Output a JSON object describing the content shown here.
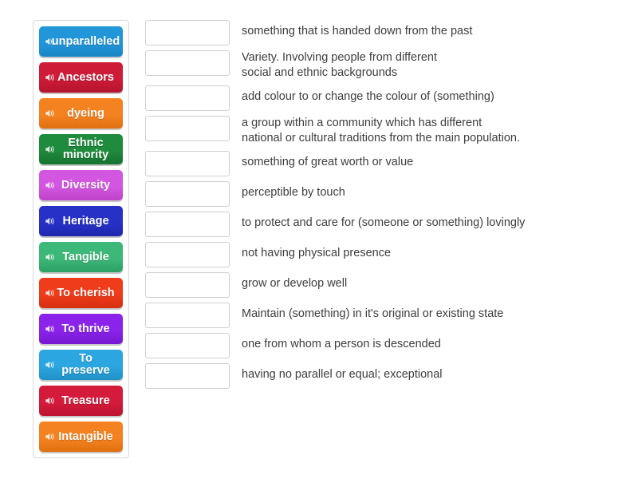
{
  "tiles": {
    "panel_name": "word-tiles",
    "items": [
      {
        "label": "unparalleled",
        "color": "#2196d9",
        "color_dark": "#1b86c4",
        "icon": "speaker-icon"
      },
      {
        "label": "Ancestors",
        "color": "#ce1b37",
        "color_dark": "#b5142e",
        "icon": "speaker-icon"
      },
      {
        "label": "dyeing",
        "color": "#f58220",
        "color_dark": "#e0700f",
        "icon": "speaker-icon"
      },
      {
        "label": "Ethnic\nminority",
        "color": "#1f8b3d",
        "color_dark": "#177331",
        "icon": "speaker-icon"
      },
      {
        "label": "Diversity",
        "color": "#d356e0",
        "color_dark": "#bd42c9",
        "icon": "speaker-icon"
      },
      {
        "label": "Heritage",
        "color": "#2731c7",
        "color_dark": "#1f27ad",
        "icon": "speaker-icon"
      },
      {
        "label": "Tangible",
        "color": "#3cb878",
        "color_dark": "#2ea165",
        "icon": "speaker-icon"
      },
      {
        "label": "To cherish",
        "color": "#ef3c1a",
        "color_dark": "#d52f10",
        "icon": "speaker-icon"
      },
      {
        "label": "To thrive",
        "color": "#8b23ea",
        "color_dark": "#7718d0",
        "icon": "speaker-icon"
      },
      {
        "label": "To\npreserve",
        "color": "#2ba6e0",
        "color_dark": "#2091c7",
        "icon": "speaker-icon"
      },
      {
        "label": "Treasure",
        "color": "#d51b3b",
        "color_dark": "#bb1431",
        "icon": "speaker-icon"
      },
      {
        "label": "Intangible",
        "color": "#f58220",
        "color_dark": "#e0700f",
        "icon": "speaker-icon"
      }
    ]
  },
  "answers": {
    "panel_name": "definition-answers",
    "drop_box_value": "",
    "rows": [
      {
        "definition": "something that is handed down from the past",
        "lines": 1
      },
      {
        "definition": "Variety. Involving people from different\nsocial and ethnic backgrounds",
        "lines": 2
      },
      {
        "definition": "add colour to or change the colour of (something)",
        "lines": 1
      },
      {
        "definition": "a group within a community which has different\nnational or cultural traditions from the main population.",
        "lines": 2
      },
      {
        "definition": "something of great worth or value",
        "lines": 1
      },
      {
        "definition": "perceptible by touch",
        "lines": 1
      },
      {
        "definition": "to protect and care for (someone or something) lovingly",
        "lines": 1
      },
      {
        "definition": "not having physical presence",
        "lines": 1
      },
      {
        "definition": "grow or develop well",
        "lines": 1
      },
      {
        "definition": "Maintain (something) in it's original or existing state",
        "lines": 1
      },
      {
        "definition": "one from whom a person is descended",
        "lines": 1
      },
      {
        "definition": "having no parallel or equal; exceptional",
        "lines": 1
      }
    ]
  },
  "theme": {
    "page_background": "#ffffff",
    "panel_border": "#d8d8d8",
    "drop_box_border": "#cfcfcf",
    "definition_text": "#3d3d3d",
    "tile_text": "#ffffff"
  }
}
